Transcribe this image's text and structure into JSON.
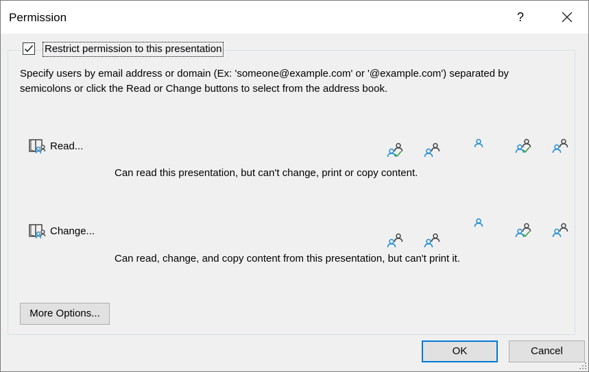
{
  "window": {
    "title": "Permission",
    "help_label": "?"
  },
  "restrict": {
    "label": "Restrict permission to this presentation",
    "checked": true
  },
  "description": "Specify users by email address or domain (Ex: 'someone@example.com' or '@example.com') separated by semicolons or click the Read or Change buttons to select from the address book.",
  "read": {
    "button_label": "Read...",
    "description": "Can read this presentation, but can't change, print or copy content.",
    "icon": "book-users-icon"
  },
  "change": {
    "button_label": "Change...",
    "description": "Can read, change, and copy content from this presentation, but can't print it.",
    "icon": "book-users-icon"
  },
  "user_icons": [
    "user-pair-check-icon",
    "user-pair-icon",
    "single-user-icon",
    "user-pair-check-icon",
    "user-pair-icon"
  ],
  "buttons": {
    "more_options": "More Options...",
    "ok": "OK",
    "cancel": "Cancel"
  },
  "colors": {
    "accent": "#0078d7",
    "user_blue": "#1f8dd6",
    "user_gray": "#555555",
    "check_green": "#2e9e3e"
  }
}
